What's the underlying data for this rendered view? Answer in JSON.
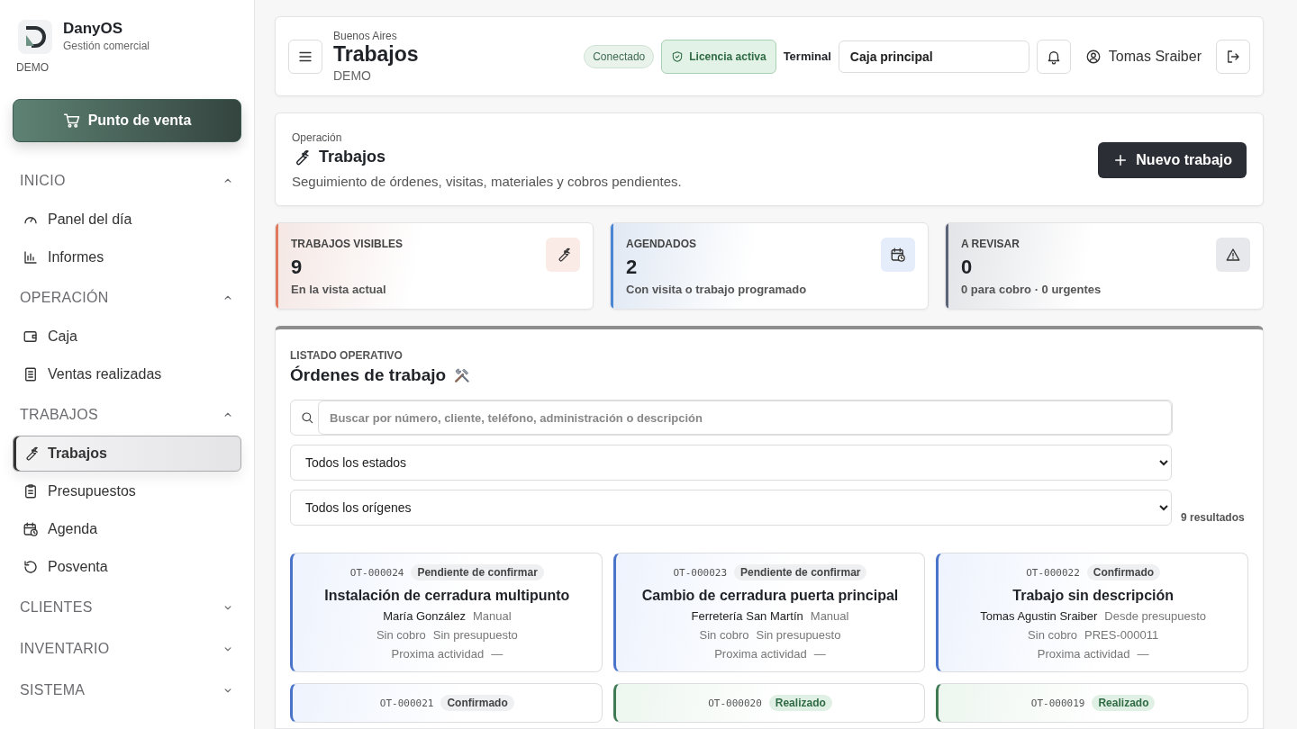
{
  "brand": {
    "name": "DanyOS",
    "subtitle": "Gestión comercial",
    "edition": "DEMO"
  },
  "pos_button": "Punto de venta",
  "sidebar": [
    {
      "title": "INICIO",
      "expanded": true,
      "items": [
        {
          "label": "Panel del día",
          "selected": false
        },
        {
          "label": "Informes",
          "selected": false
        }
      ]
    },
    {
      "title": "OPERACIÓN",
      "expanded": true,
      "items": [
        {
          "label": "Caja",
          "selected": false
        },
        {
          "label": "Ventas realizadas",
          "selected": false
        }
      ]
    },
    {
      "title": "TRABAJOS",
      "expanded": true,
      "items": [
        {
          "label": "Trabajos",
          "selected": true
        },
        {
          "label": "Presupuestos",
          "selected": false
        },
        {
          "label": "Agenda",
          "selected": false
        },
        {
          "label": "Posventa",
          "selected": false
        }
      ]
    },
    {
      "title": "CLIENTES",
      "expanded": false
    },
    {
      "title": "INVENTARIO",
      "expanded": false
    },
    {
      "title": "SISTEMA",
      "expanded": false
    }
  ],
  "header": {
    "location": "Buenos Aires",
    "title": "Trabajos",
    "edition": "DEMO",
    "connection": "Conectado",
    "license": "Licencia activa",
    "terminal_label": "Terminal",
    "terminal_value": "Caja principal",
    "user": "Tomas Sraiber"
  },
  "page": {
    "eyebrow": "Operación",
    "title": "Trabajos",
    "description": "Seguimiento de órdenes, visitas, materiales y cobros pendientes.",
    "new_button": "Nuevo trabajo"
  },
  "stats": [
    {
      "label": "TRABAJOS VISIBLES",
      "value": "9",
      "note": "En la vista actual",
      "color": "#e07a5f"
    },
    {
      "label": "AGENDADOS",
      "value": "2",
      "note": "Con visita o trabajo programado",
      "color": "#4a86d4"
    },
    {
      "label": "A REVISAR",
      "value": "0",
      "note": "0 para cobro · 0 urgentes",
      "color": "#5b6477"
    }
  ],
  "list": {
    "eyebrow": "LISTADO OPERATIVO",
    "title": "Órdenes de trabajo",
    "search_placeholder": "Buscar por número, cliente, teléfono, administración o descripción",
    "status_filter": "Todos los estados",
    "origin_filter": "Todos los orígenes",
    "results": "9 resultados"
  },
  "orders": [
    {
      "id": "OT-000024",
      "status": "Pendiente de confirmar",
      "kind": "pending",
      "title": "Instalación de cerradura multipunto",
      "client": "María González",
      "origin": "Manual",
      "billing": "Sin cobro",
      "budget": "Sin presupuesto",
      "next_label": "Proxima actividad",
      "next_value": "—"
    },
    {
      "id": "OT-000023",
      "status": "Pendiente de confirmar",
      "kind": "pending",
      "title": "Cambio de cerradura puerta principal",
      "client": "Ferretería San Martín",
      "origin": "Manual",
      "billing": "Sin cobro",
      "budget": "Sin presupuesto",
      "next_label": "Proxima actividad",
      "next_value": "—"
    },
    {
      "id": "OT-000022",
      "status": "Confirmado",
      "kind": "confirmed",
      "title": "Trabajo sin descripción",
      "client": "Tomas Agustin Sraiber",
      "origin": "Desde presupuesto",
      "billing": "Sin cobro",
      "budget": "PRES-000011",
      "next_label": "Proxima actividad",
      "next_value": "—"
    },
    {
      "id": "OT-000021",
      "status": "Confirmado",
      "kind": "confirmed"
    },
    {
      "id": "OT-000020",
      "status": "Realizado",
      "kind": "done"
    },
    {
      "id": "OT-000019",
      "status": "Realizado",
      "kind": "done"
    }
  ]
}
